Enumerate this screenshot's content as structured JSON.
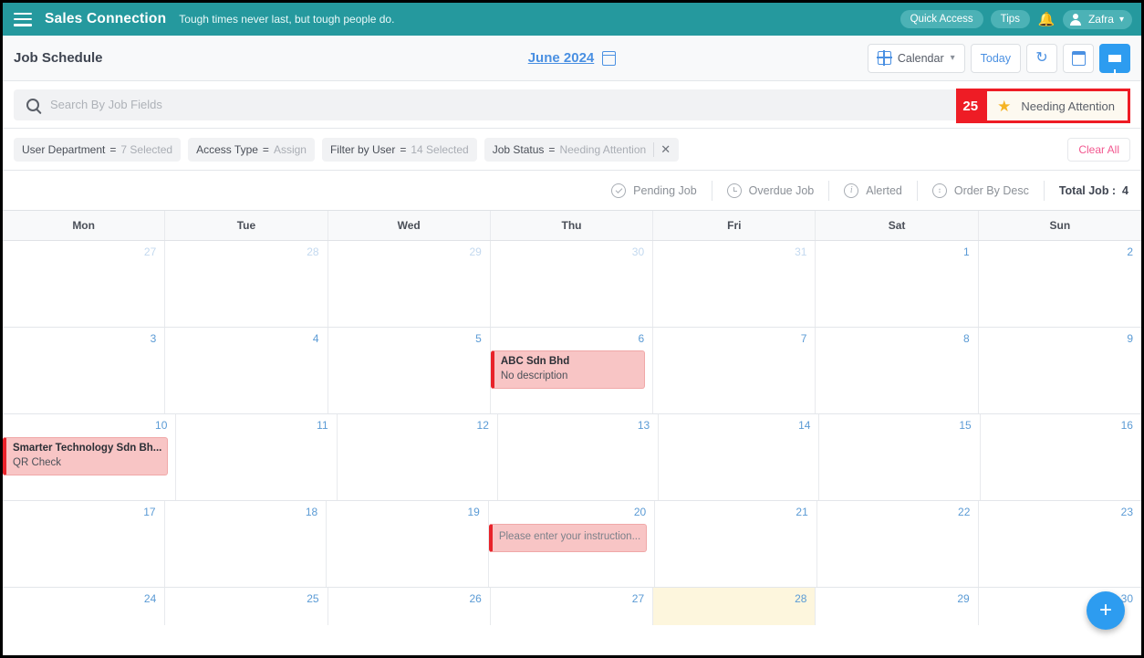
{
  "topbar": {
    "menu_icon": "hamburger-icon",
    "brand": "Sales Connection",
    "tagline": "Tough times never last, but tough people do.",
    "quick_access": "Quick Access",
    "tips": "Tips",
    "bell_icon": "bell-icon",
    "user_name": "Zafra",
    "teal": "#25999e"
  },
  "titlerow": {
    "page_title": "Job Schedule",
    "month": "June 2024",
    "calendar_icon": "calendar-icon",
    "view_label": "Calendar",
    "today_label": "Today",
    "refresh_icon": "refresh-icon",
    "date_picker_icon": "calendar-icon",
    "filter_icon": "filter-icon"
  },
  "search": {
    "placeholder": "Search By Job Fields",
    "value": "",
    "search_icon": "search-icon",
    "annotation_number": "25",
    "needing_attention_label": "Needing Attention",
    "star_icon": "star-icon",
    "annotation_color": "#ee1c25"
  },
  "filters": {
    "chips": [
      {
        "label": "User Department",
        "eq": "=",
        "value": "7 Selected",
        "removable": false
      },
      {
        "label": "Access Type",
        "eq": "=",
        "value": "Assign",
        "removable": false
      },
      {
        "label": "Filter by User",
        "eq": "=",
        "value": "14 Selected",
        "removable": false
      },
      {
        "label": "Job Status",
        "eq": "=",
        "value": "Needing Attention",
        "removable": true
      }
    ],
    "clear_all": "Clear All"
  },
  "legend": {
    "items": [
      {
        "label": "Pending Job",
        "icon": "check-circle-icon"
      },
      {
        "label": "Overdue Job",
        "icon": "clock-icon"
      },
      {
        "label": "Alerted",
        "icon": "info-icon"
      },
      {
        "label": "Order By Desc",
        "icon": "sort-desc-icon"
      }
    ],
    "total_label": "Total Job :",
    "total_value": "4"
  },
  "calendar": {
    "weekday_headers": [
      "Mon",
      "Tue",
      "Wed",
      "Thu",
      "Fri",
      "Sat",
      "Sun"
    ],
    "weeks": [
      [
        {
          "num": "27",
          "other": true,
          "today": false,
          "events": []
        },
        {
          "num": "28",
          "other": true,
          "today": false,
          "events": []
        },
        {
          "num": "29",
          "other": true,
          "today": false,
          "events": []
        },
        {
          "num": "30",
          "other": true,
          "today": false,
          "events": []
        },
        {
          "num": "31",
          "other": true,
          "today": false,
          "events": []
        },
        {
          "num": "1",
          "other": false,
          "today": false,
          "events": []
        },
        {
          "num": "2",
          "other": false,
          "today": false,
          "events": []
        }
      ],
      [
        {
          "num": "3",
          "other": false,
          "today": false,
          "events": []
        },
        {
          "num": "4",
          "other": false,
          "today": false,
          "events": []
        },
        {
          "num": "5",
          "other": false,
          "today": false,
          "events": []
        },
        {
          "num": "6",
          "other": false,
          "today": false,
          "events": [
            {
              "title": "ABC Sdn Bhd",
              "desc": "No description"
            }
          ]
        },
        {
          "num": "7",
          "other": false,
          "today": false,
          "events": []
        },
        {
          "num": "8",
          "other": false,
          "today": false,
          "events": []
        },
        {
          "num": "9",
          "other": false,
          "today": false,
          "events": []
        }
      ],
      [
        {
          "num": "10",
          "other": false,
          "today": false,
          "events": [
            {
              "title": "Smarter Technology Sdn Bh...",
              "desc": "QR Check"
            }
          ]
        },
        {
          "num": "11",
          "other": false,
          "today": false,
          "events": []
        },
        {
          "num": "12",
          "other": false,
          "today": false,
          "events": []
        },
        {
          "num": "13",
          "other": false,
          "today": false,
          "events": []
        },
        {
          "num": "14",
          "other": false,
          "today": false,
          "events": []
        },
        {
          "num": "15",
          "other": false,
          "today": false,
          "events": []
        },
        {
          "num": "16",
          "other": false,
          "today": false,
          "events": []
        }
      ],
      [
        {
          "num": "17",
          "other": false,
          "today": false,
          "events": []
        },
        {
          "num": "18",
          "other": false,
          "today": false,
          "events": []
        },
        {
          "num": "19",
          "other": false,
          "today": false,
          "events": []
        },
        {
          "num": "20",
          "other": false,
          "today": false,
          "events": [
            {
              "title": "",
              "desc": "Please enter your instruction..."
            }
          ]
        },
        {
          "num": "21",
          "other": false,
          "today": false,
          "events": []
        },
        {
          "num": "22",
          "other": false,
          "today": false,
          "events": []
        },
        {
          "num": "23",
          "other": false,
          "today": false,
          "events": []
        }
      ],
      [
        {
          "num": "24",
          "other": false,
          "today": false,
          "events": []
        },
        {
          "num": "25",
          "other": false,
          "today": false,
          "events": []
        },
        {
          "num": "26",
          "other": false,
          "today": false,
          "events": []
        },
        {
          "num": "27",
          "other": false,
          "today": false,
          "events": []
        },
        {
          "num": "28",
          "other": false,
          "today": true,
          "events": []
        },
        {
          "num": "29",
          "other": false,
          "today": false,
          "events": []
        },
        {
          "num": "30",
          "other": false,
          "today": false,
          "events": []
        }
      ]
    ]
  },
  "fab": {
    "label": "+"
  }
}
